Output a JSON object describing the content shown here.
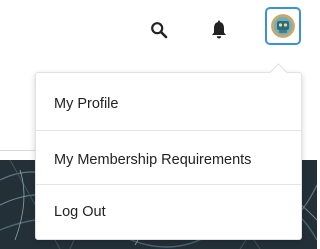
{
  "header": {
    "icons": [
      "search-icon",
      "bell-icon"
    ],
    "avatar": {
      "icon": "user-avatar",
      "ring_color": "#3b93d6"
    }
  },
  "menu": {
    "items": [
      {
        "label": "My Profile"
      },
      {
        "label": "My Membership Requirements"
      },
      {
        "label": "Log Out"
      }
    ]
  },
  "colors": {
    "accent": "#3b93d6",
    "text": "#222222",
    "hero_bg": "#243038"
  }
}
